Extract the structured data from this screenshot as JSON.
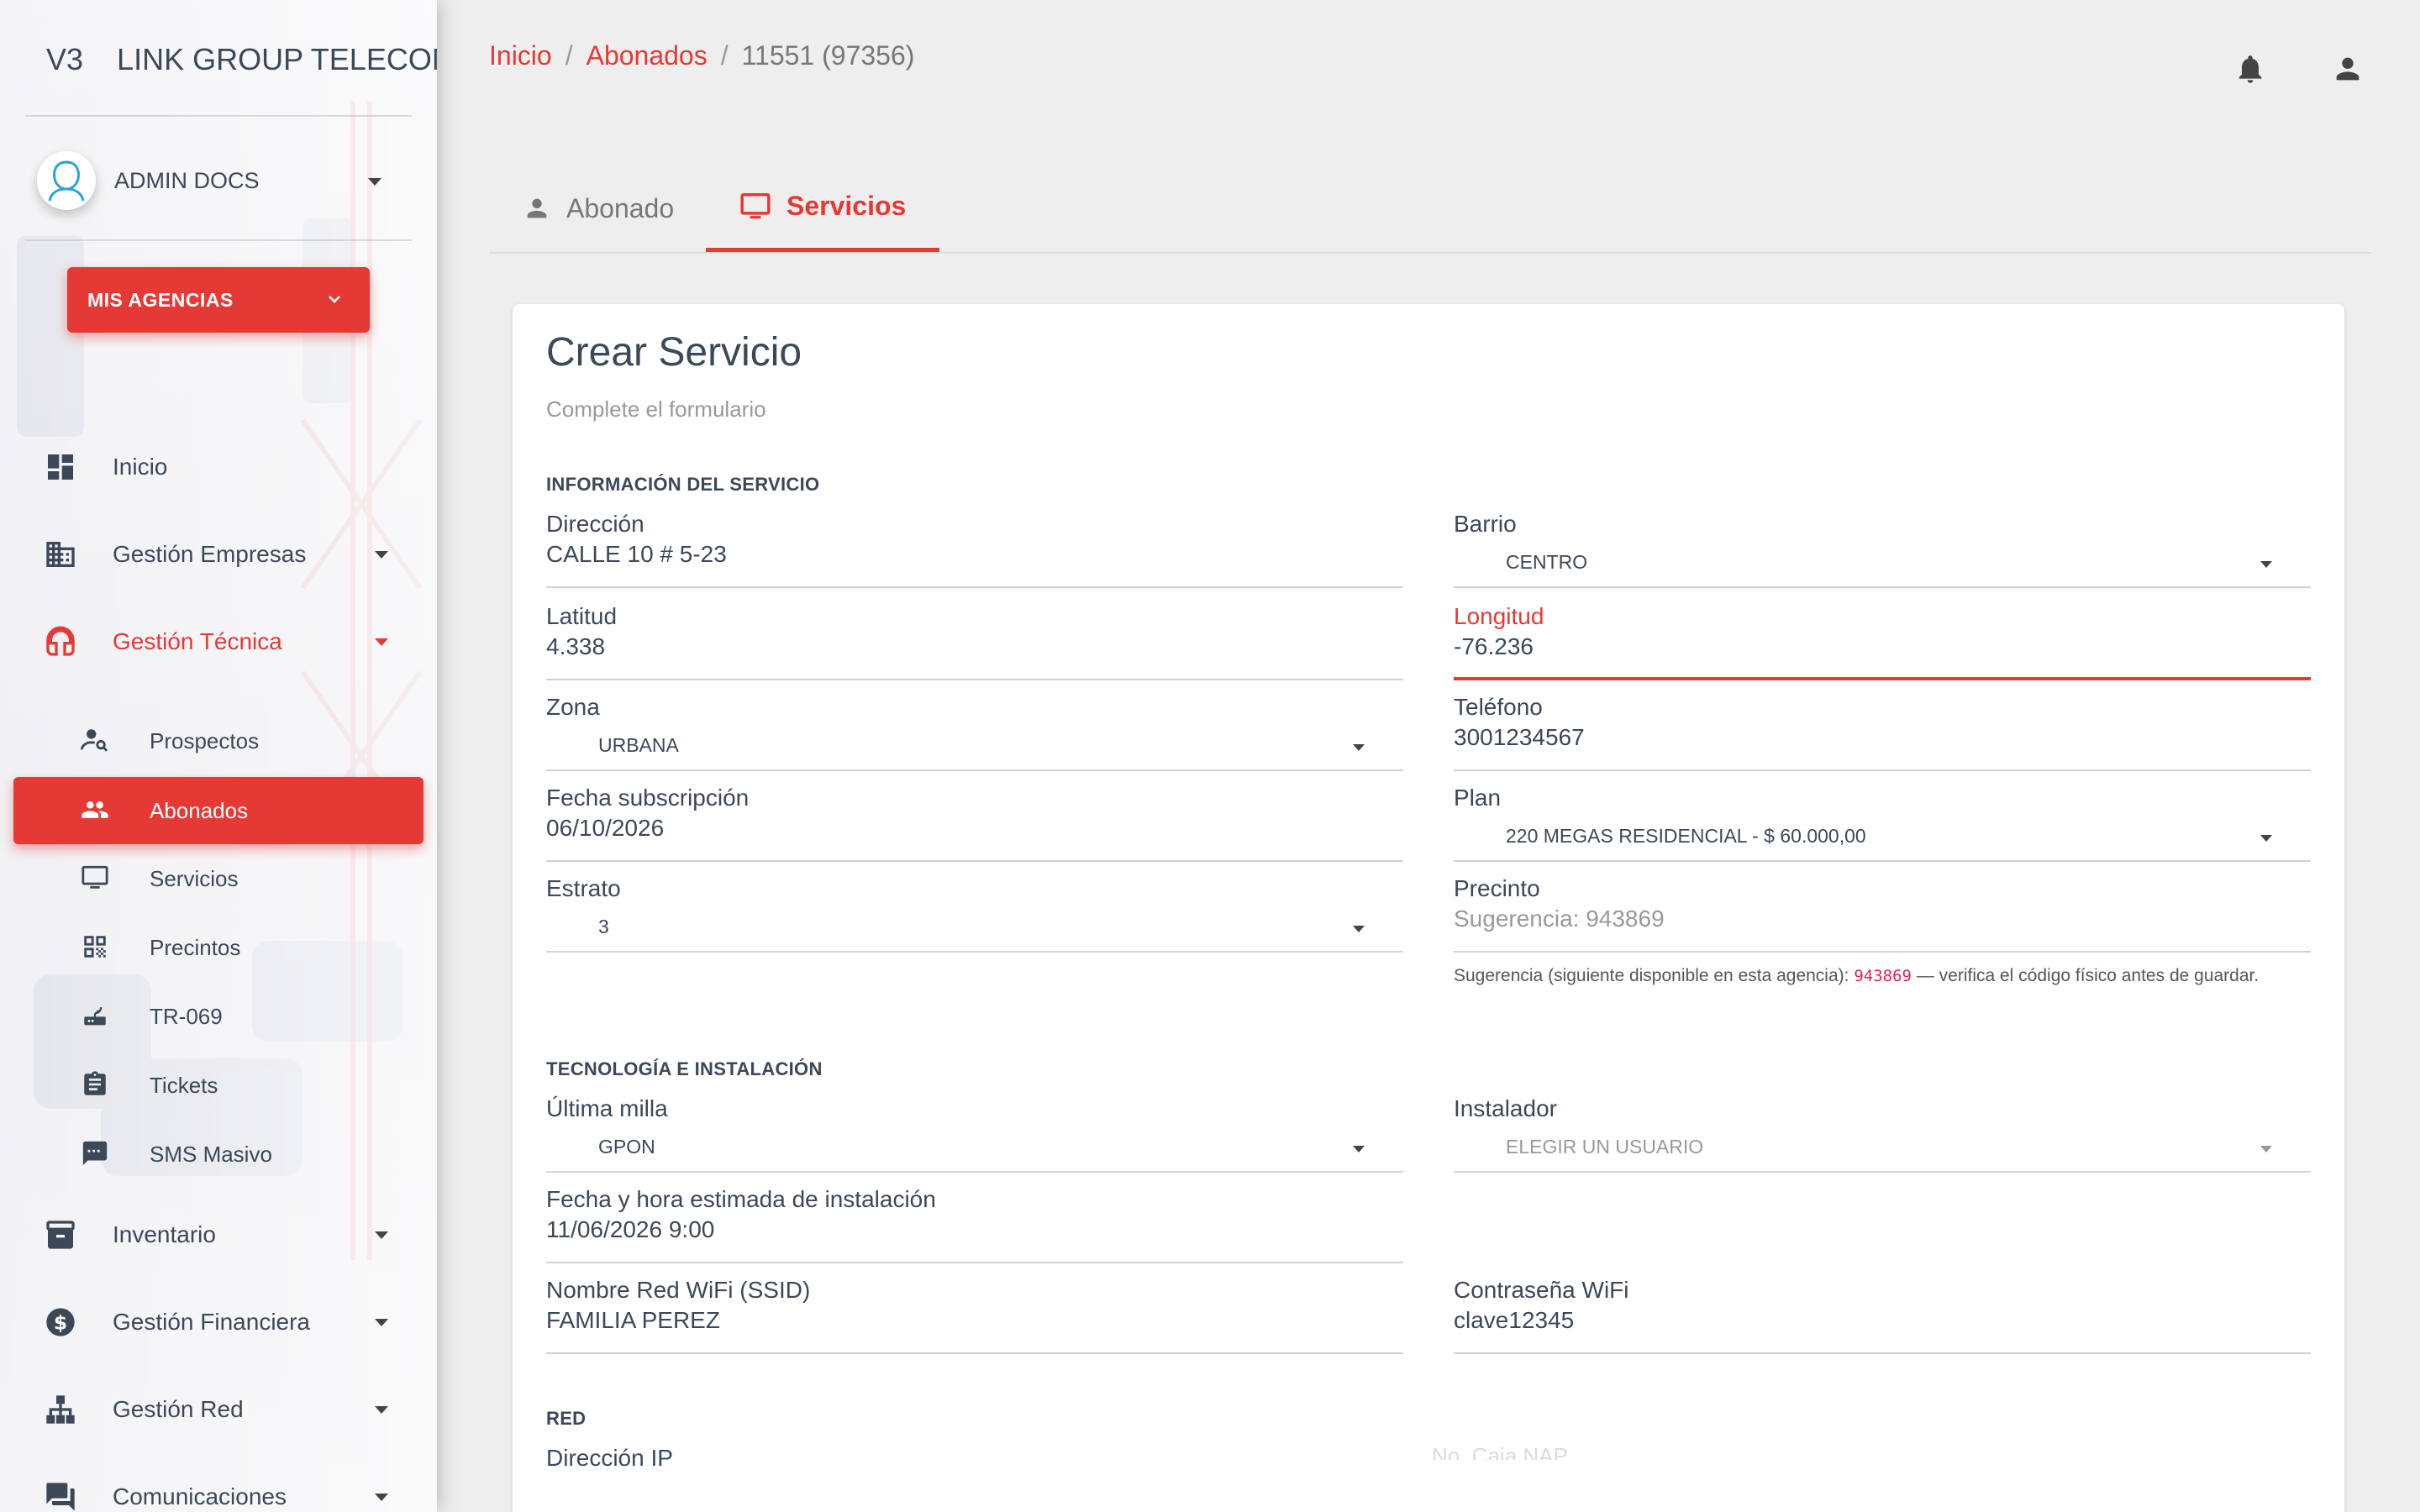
{
  "sidebar": {
    "logo_prefix": "V3",
    "logo_text": "LINK GROUP TELECOMU",
    "user_name": "ADMIN DOCS",
    "agency_button": "MIS AGENCIAS",
    "nav": {
      "inicio": "Inicio",
      "empresas": "Gestión Empresas",
      "tecnica": "Gestión Técnica",
      "inventario": "Inventario",
      "financiera": "Gestión Financiera",
      "red": "Gestión Red",
      "comunicaciones": "Comunicaciones"
    },
    "sub": {
      "prospectos": "Prospectos",
      "abonados": "Abonados",
      "servicios": "Servicios",
      "precintos": "Precintos",
      "tr069": "TR-069",
      "tickets": "Tickets",
      "sms": "SMS Masivo"
    }
  },
  "breadcrumb": {
    "home": "Inicio",
    "abonados": "Abonados",
    "current": "11551 (97356)"
  },
  "tabs": {
    "abonado": "Abonado",
    "servicios": "Servicios"
  },
  "form": {
    "title": "Crear Servicio",
    "subtitle": "Complete el formulario",
    "section_info": "INFORMACIÓN DEL SERVICIO",
    "section_tech": "TECNOLOGÍA E INSTALACIÓN",
    "section_red": "RED",
    "direccion": {
      "label": "Dirección",
      "value": "CALLE 10 # 5-23"
    },
    "barrio": {
      "label": "Barrio",
      "value": "CENTRO"
    },
    "latitud": {
      "label": "Latitud",
      "value": "4.338"
    },
    "longitud": {
      "label": "Longitud",
      "value": "-76.236"
    },
    "zona": {
      "label": "Zona",
      "value": "URBANA"
    },
    "telefono": {
      "label": "Teléfono",
      "value": "3001234567"
    },
    "fecha_sub": {
      "label": "Fecha subscripción",
      "value": "06/10/2026"
    },
    "plan": {
      "label": "Plan",
      "value": "220 MEGAS RESIDENCIAL - $ 60.000,00"
    },
    "estrato": {
      "label": "Estrato",
      "value": "3"
    },
    "precinto": {
      "label": "Precinto",
      "placeholder": "Sugerencia: 943869"
    },
    "hint": {
      "before": "Sugerencia (siguiente disponible en esta agencia):",
      "code": "943869",
      "after": "— verifica el código físico antes de guardar."
    },
    "ultima_milla": {
      "label": "Última milla",
      "value": "GPON"
    },
    "instalador": {
      "label": "Instalador",
      "placeholder": "ELEGIR UN USUARIO"
    },
    "fecha_inst": {
      "label": "Fecha y hora estimada de instalación",
      "value": "11/06/2026 9:00"
    },
    "ssid": {
      "label": "Nombre Red WiFi (SSID)",
      "value": "FAMILIA PEREZ"
    },
    "wifi_pass": {
      "label": "Contraseña WiFi",
      "value": "clave12345"
    },
    "ip": {
      "label": "Dirección IP"
    },
    "caja_nap": {
      "label": "No. Caja NAP"
    }
  },
  "colors": {
    "accent": "#e53935",
    "text": "#3c4858",
    "muted": "#999999"
  }
}
